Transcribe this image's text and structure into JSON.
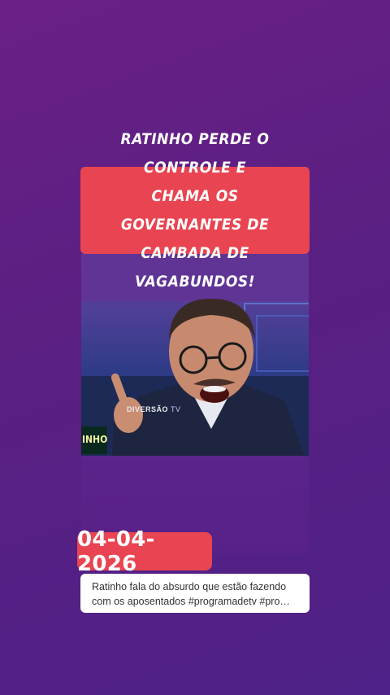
{
  "story": {
    "headline": "RATINHO PERDE O CONTROLE E\nCHAMA OS GOVERNANTES DE\nCAMBADA DE VAGABUNDOS!",
    "video": {
      "watermark_brand": "DIVERSÃO",
      "watermark_suffix": "TV",
      "desk_text": "INHO"
    },
    "date": "04-04-2026",
    "caption_line1": "Ratinho fala do absurdo que estão fazendo",
    "caption_line2": "com os aposentados #programadetv #pro…"
  },
  "colors": {
    "background": "#5e1f85",
    "accent_red": "#e94451",
    "caption_bg": "#ffffff"
  }
}
